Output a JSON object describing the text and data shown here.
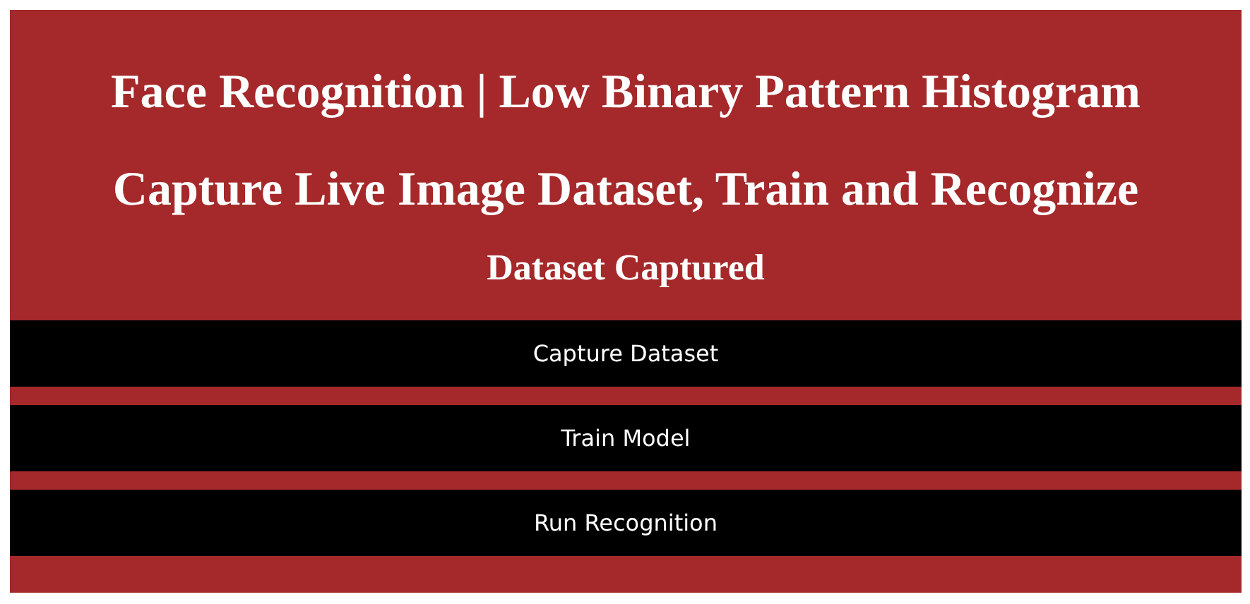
{
  "headings": [
    "Face Recognition | Low Binary Pattern Histogram",
    "Capture Live Image Dataset, Train and Recognize"
  ],
  "status": "Dataset Captured",
  "buttons": [
    "Capture Dataset",
    "Train Model",
    "Run Recognition"
  ]
}
